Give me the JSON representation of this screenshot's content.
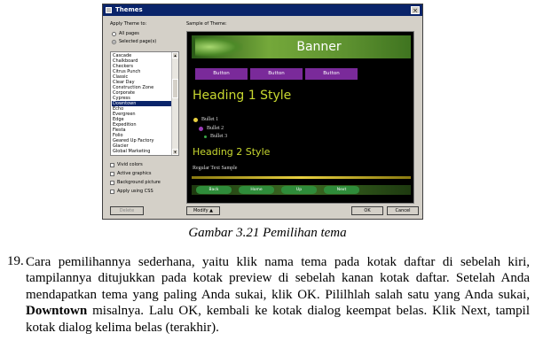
{
  "dialog": {
    "title": "Themes",
    "close_glyph": "×",
    "apply_label": "Apply Theme to:",
    "sample_label": "Sample of Theme:",
    "radio_all": "All pages",
    "radio_selected": "Selected page(s)",
    "themes": [
      "Cascade",
      "Chalkboard",
      "Checkers",
      "Citrus Punch",
      "Classic",
      "Clear Day",
      "Construction Zone",
      "Corporate",
      "Cypress",
      "Downtown",
      "Echo",
      "Evergreen",
      "Edge",
      "Expedition",
      "Fiesta",
      "Folio",
      "Geared Up Factory",
      "Glacier",
      "Global Marketing"
    ],
    "selected_theme": "Downtown",
    "checkboxes": [
      "Vivid colors",
      "Active graphics",
      "Background picture",
      "Apply using CSS"
    ],
    "delete_label": "Delete",
    "modify_label": "Modify",
    "ok_label": "OK",
    "cancel_label": "Cancel",
    "scroll_up_glyph": "▲",
    "scroll_down_glyph": "▼"
  },
  "preview": {
    "banner_text": "Banner",
    "buttons": [
      "Button",
      "Button",
      "Button"
    ],
    "heading1": "Heading 1 Style",
    "bullets": [
      "Bullet 1",
      "Bullet 2",
      "Bullet 3"
    ],
    "heading2": "Heading 2 Style",
    "regular_text": "Regular Text Sample",
    "nav": [
      "Back",
      "Home",
      "Up",
      "Next"
    ],
    "colors": {
      "heading": "#c8d830",
      "button": "#7a2a9a",
      "nav": "#2f8c3a"
    }
  },
  "caption": "Gambar 3.21 Pemilihan tema",
  "paragraph": {
    "number": "19.",
    "text_before": "Cara pemilihannya sederhana, yaitu klik nama tema pada kotak daftar di sebelah kiri, tampilannya ditujukkan pada kotak preview di sebelah kanan kotak daftar. Setelah Anda mendapatkan tema yang paling Anda sukai, klik OK. Pililhlah salah satu yang Anda sukai, ",
    "bold": "Downtown",
    "text_after": " misalnya. Lalu OK, kembali ke kotak dialog keempat belas. Klik Next, tampil kotak dialog kelima belas (terakhir)."
  }
}
